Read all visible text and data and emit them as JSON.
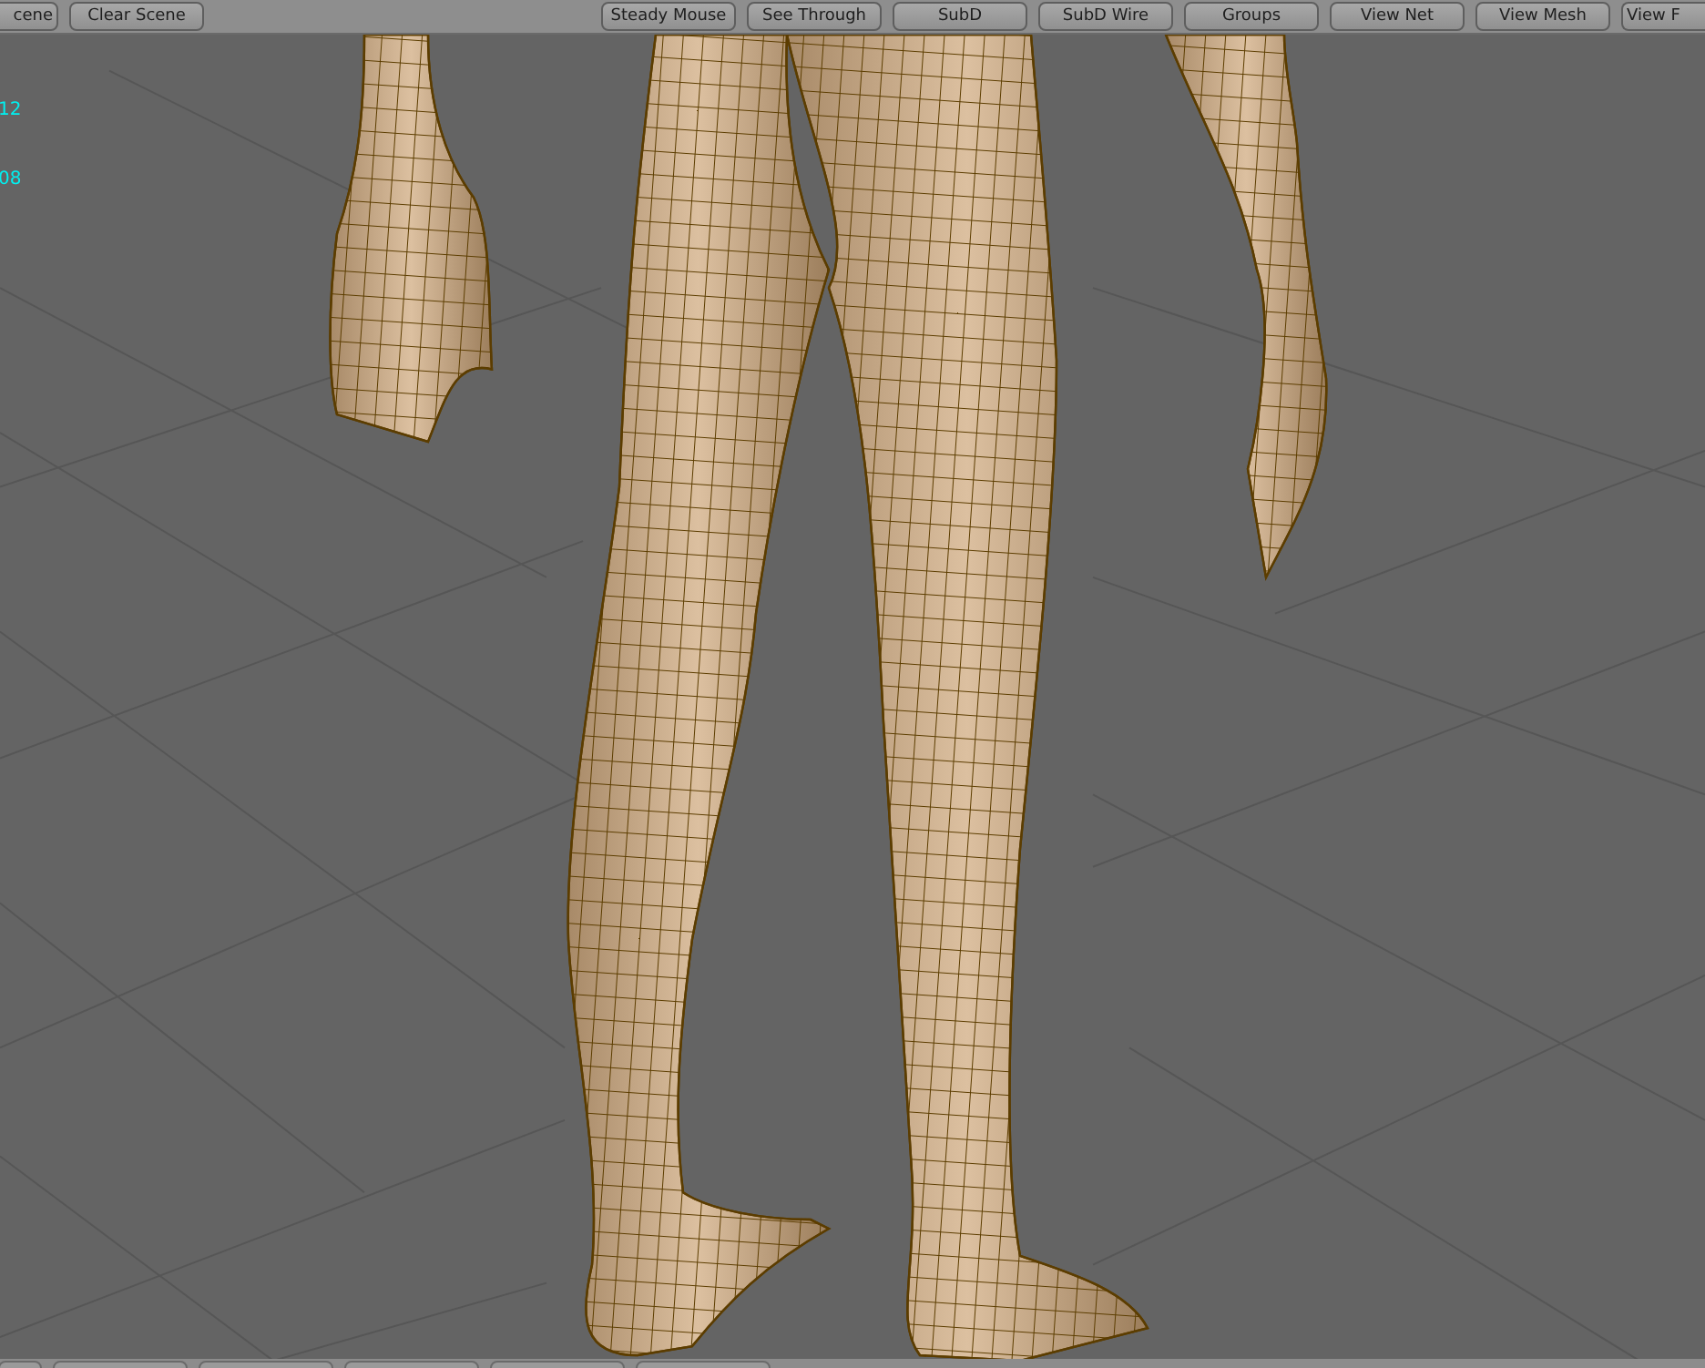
{
  "toolbar": {
    "left_buttons": [
      {
        "label": "cene"
      },
      {
        "label": "Clear Scene"
      }
    ],
    "right_buttons": [
      {
        "label": "Steady Mouse"
      },
      {
        "label": "See Through"
      },
      {
        "label": "SubD"
      },
      {
        "label": "SubD Wire"
      },
      {
        "label": "Groups"
      },
      {
        "label": "View Net"
      },
      {
        "label": "View Mesh"
      },
      {
        "label": "View F"
      }
    ]
  },
  "viewport": {
    "readouts": [
      "12",
      "08"
    ]
  },
  "bottom_toolbar": {
    "buttons": [
      {
        "kind": "button"
      },
      {
        "kind": "button"
      },
      {
        "kind": "button"
      },
      {
        "kind": "button"
      },
      {
        "kind": "button"
      },
      {
        "kind": "button"
      }
    ]
  }
}
